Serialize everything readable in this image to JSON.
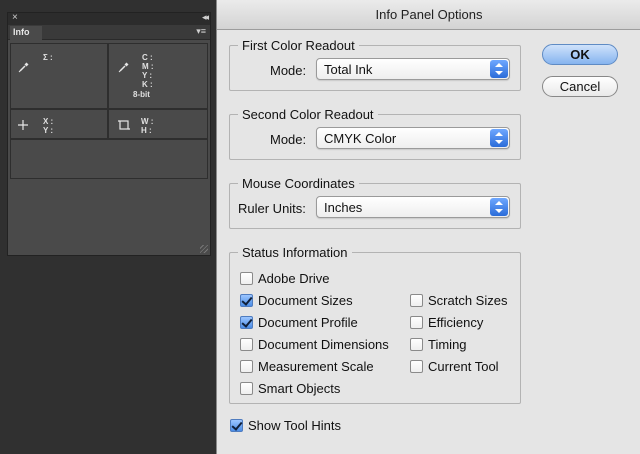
{
  "info_panel": {
    "tab_label": "Info",
    "close_glyph": "×",
    "collapse_glyph": "◂◂",
    "menu_glyph": "▾≡",
    "sigma_label": "Σ :",
    "cmyk_labels": [
      "C :",
      "M :",
      "Y :",
      "K :"
    ],
    "bit_depth": "8-bit",
    "xy_labels": [
      "X :",
      "Y :"
    ],
    "wh_labels": [
      "W :",
      "H :"
    ]
  },
  "dialog": {
    "title": "Info Panel Options",
    "ok_label": "OK",
    "cancel_label": "Cancel",
    "first_readout": {
      "title": "First Color Readout",
      "mode_label": "Mode:",
      "mode_value": "Total Ink"
    },
    "second_readout": {
      "title": "Second Color Readout",
      "mode_label": "Mode:",
      "mode_value": "CMYK Color"
    },
    "mouse": {
      "title": "Mouse Coordinates",
      "units_label": "Ruler Units:",
      "units_value": "Inches"
    },
    "status": {
      "title": "Status Information",
      "left": [
        {
          "label": "Adobe Drive",
          "checked": false
        },
        {
          "label": "Document Sizes",
          "checked": true
        },
        {
          "label": "Document Profile",
          "checked": true
        },
        {
          "label": "Document Dimensions",
          "checked": false
        },
        {
          "label": "Measurement Scale",
          "checked": false
        },
        {
          "label": "Smart Objects",
          "checked": false
        }
      ],
      "right": [
        {
          "label": "Scratch Sizes",
          "checked": false
        },
        {
          "label": "Efficiency",
          "checked": false
        },
        {
          "label": "Timing",
          "checked": false
        },
        {
          "label": "Current Tool",
          "checked": false
        }
      ]
    },
    "show_tool_hints": {
      "label": "Show Tool Hints",
      "checked": true
    }
  }
}
